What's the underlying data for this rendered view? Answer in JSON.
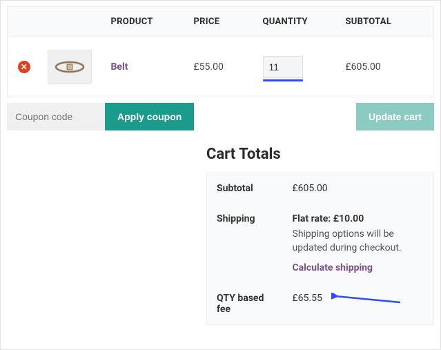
{
  "headers": {
    "product": "PRODUCT",
    "price": "PRICE",
    "quantity": "QUANTITY",
    "subtotal": "SUBTOTAL"
  },
  "items": [
    {
      "name": "Belt",
      "price": "£55.00",
      "quantity": "11",
      "subtotal": "£605.00"
    }
  ],
  "coupon": {
    "placeholder": "Coupon code",
    "apply": "Apply coupon"
  },
  "update_cart": "Update cart",
  "totals_heading": "Cart Totals",
  "totals": {
    "subtotal_label": "Subtotal",
    "subtotal_value": "£605.00",
    "shipping_label": "Shipping",
    "flat_rate": "Flat rate: £10.00",
    "shipping_note": "Shipping options will be updated during checkout.",
    "calculate": "Calculate shipping",
    "fee_label": "QTY based fee",
    "fee_value": "£65.55"
  }
}
